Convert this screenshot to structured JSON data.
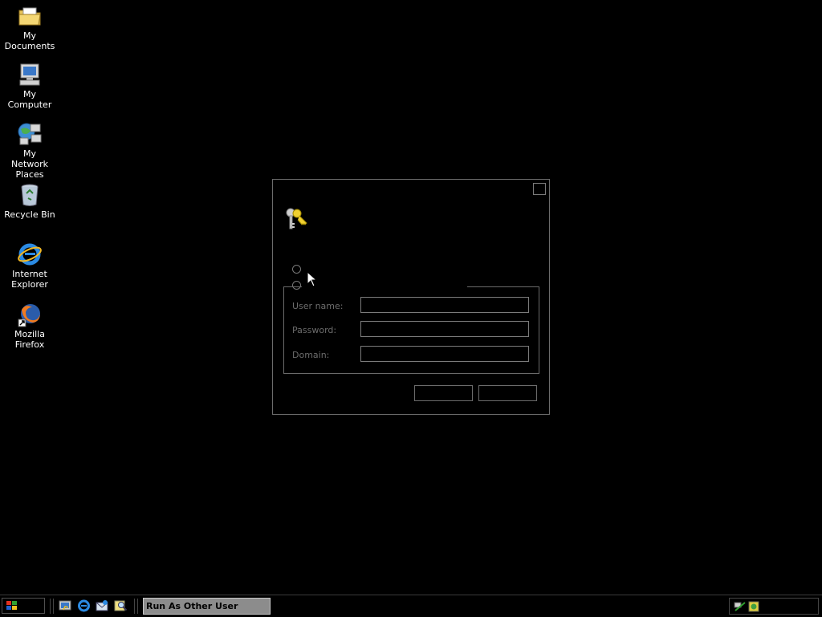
{
  "desktop": {
    "icons": [
      {
        "label": "My Documents",
        "icon": "folder-icon"
      },
      {
        "label": "My Computer",
        "icon": "computer-icon"
      },
      {
        "label": "My Network Places",
        "icon": "network-icon"
      },
      {
        "label": "Recycle Bin",
        "icon": "recycle-bin-icon"
      },
      {
        "label": "Internet Explorer",
        "icon": "internet-explorer-icon"
      },
      {
        "label": "Mozilla Firefox",
        "icon": "firefox-icon"
      }
    ]
  },
  "dialog": {
    "labels": {
      "username": "User name:",
      "password": "Password:",
      "domain": "Domain:"
    },
    "fields": {
      "username": "",
      "password": "",
      "domain": ""
    },
    "buttons": {
      "ok": "",
      "cancel": ""
    }
  },
  "taskbar": {
    "active_task": "Run As Other User"
  },
  "colors": {
    "background": "#000000",
    "task_button": "#8c8c8c",
    "border": "#6b6b6b"
  }
}
